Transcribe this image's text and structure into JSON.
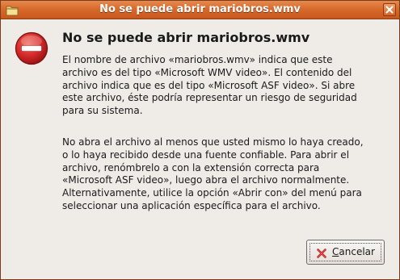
{
  "window": {
    "title": "No se puede abrir mariobros.wmv",
    "icon": "folder-icon",
    "close_icon": "close-icon"
  },
  "dialog": {
    "icon": "error-icon",
    "heading": "No se puede abrir mariobros.wmv",
    "paragraph_1": [
      "El nombre de archivo «mariobros.wmv» indica que este",
      "archivo es del tipo «Microsoft WMV video». El contenido del",
      "archivo indica que es del tipo «Microsoft ASF video». Si abre",
      "este archivo, éste podría representar un riesgo de seguridad",
      "para su sistema."
    ],
    "paragraph_2": [
      "No abra el archivo al menos que usted mismo lo haya creado,",
      "o lo haya recibido desde una fuente confiable. Para abrir el",
      "archivo, renómbrelo a con la extensión correcta para",
      "«Microsoft ASF video», luego abra el archivo normalmente.",
      "Alternativamente, utilice la opción «Abrir con» del menú para",
      "seleccionar una aplicación específica para el archivo."
    ]
  },
  "buttons": {
    "cancel": {
      "mnemonic": "C",
      "label_rest": "ancelar",
      "icon": "cancel-x-icon"
    }
  },
  "colors": {
    "titlebar": "#d86a2c",
    "background": "#efebe7",
    "error_red": "#d42a2a"
  }
}
